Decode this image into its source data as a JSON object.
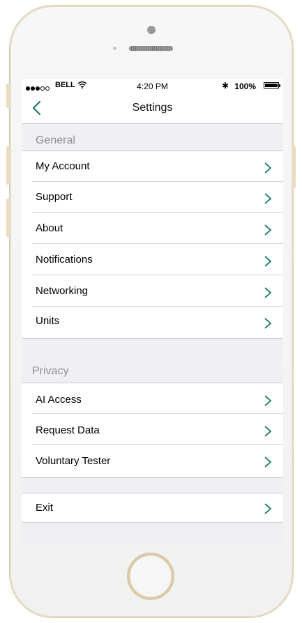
{
  "status_bar": {
    "carrier": "BELL",
    "time": "4:20 PM",
    "battery": "100%",
    "signal_dots": 5,
    "signal_filled": 3
  },
  "nav": {
    "title": "Settings"
  },
  "sections": {
    "general": {
      "header": "General",
      "items": [
        "My Account",
        "Support",
        "About",
        "Notifications",
        "Networking",
        "Units"
      ]
    },
    "privacy": {
      "header": "Privacy",
      "items": [
        "AI Access",
        "Request Data",
        "Voluntary Tester"
      ]
    },
    "exit": {
      "items": [
        "Exit"
      ]
    }
  },
  "colors": {
    "accent": "#1a7a6a",
    "background": "#efeff4",
    "header_text": "#8f8f95"
  }
}
